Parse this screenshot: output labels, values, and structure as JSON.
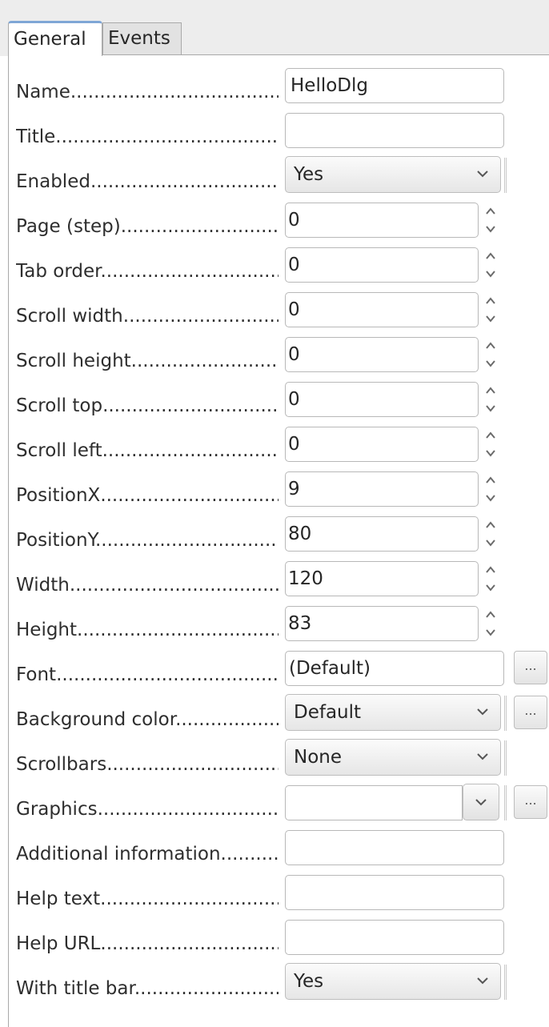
{
  "tabs": {
    "general": "General",
    "events": "Events"
  },
  "dots": "........................................................................................",
  "properties": {
    "name": {
      "label": "Name",
      "value": "HelloDlg"
    },
    "title": {
      "label": "Title",
      "value": ""
    },
    "enabled": {
      "label": "Enabled",
      "value": "Yes"
    },
    "page_step": {
      "label": "Page (step)",
      "value": "0"
    },
    "tab_order": {
      "label": "Tab order",
      "value": "0"
    },
    "scroll_width": {
      "label": "Scroll width",
      "value": "0"
    },
    "scroll_height": {
      "label": "Scroll height",
      "value": "0"
    },
    "scroll_top": {
      "label": "Scroll top",
      "value": "0"
    },
    "scroll_left": {
      "label": "Scroll left",
      "value": "0"
    },
    "position_x": {
      "label": "PositionX",
      "value": "9"
    },
    "position_y": {
      "label": "PositionY",
      "value": "80"
    },
    "width": {
      "label": "Width",
      "value": "120"
    },
    "height": {
      "label": "Height",
      "value": "83"
    },
    "font": {
      "label": "Font",
      "value": "(Default)"
    },
    "background_color": {
      "label": "Background color",
      "value": "Default"
    },
    "scrollbars": {
      "label": "Scrollbars",
      "value": "None"
    },
    "graphics": {
      "label": "Graphics",
      "value": ""
    },
    "additional_information": {
      "label": "Additional information",
      "value": ""
    },
    "help_text": {
      "label": "Help text",
      "value": ""
    },
    "help_url": {
      "label": "Help URL",
      "value": ""
    },
    "with_title_bar": {
      "label": "With title bar",
      "value": "Yes"
    }
  },
  "browse_button_label": "...",
  "icons": {
    "spin_up": "chevron-up-icon",
    "spin_down": "chevron-down-icon",
    "dropdown": "chevron-down-icon"
  },
  "colors": {
    "tab_highlight": "#7fa6d6",
    "border": "#b8b8b8",
    "background_strip": "#ededed"
  }
}
